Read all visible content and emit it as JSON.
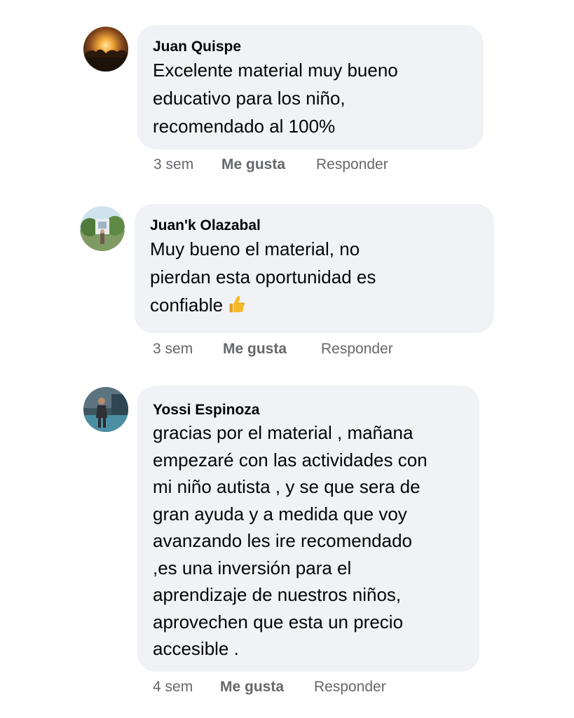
{
  "comments": [
    {
      "author": "Juan Quispe",
      "text": "Excelente material muy bueno\neducativo para los niño,\nrecomendado al 100%",
      "time": "3 sem",
      "like_label": "Me gusta",
      "reply_label": "Responder",
      "avatar_icon": "sunset-photo-avatar"
    },
    {
      "author": "Juan'k Olazabal",
      "text": "Muy bueno el material, no\npierdan esta oportunidad es\nconfiable",
      "emoji": "thumbs-up",
      "time": "3 sem",
      "like_label": "Me gusta",
      "reply_label": "Responder",
      "avatar_icon": "park-photo-avatar"
    },
    {
      "author": "Yossi Espinoza",
      "text": "gracias por el material , mañana\nempezaré con las actividades con\nmi niño autista , y se que sera de\ngran ayuda y a medida que voy\navanzando les ire recomendado\n,es una inversión para el\naprendizaje de nuestros niños,\naprovechen que esta un precio\naccesible .",
      "time": "4 sem",
      "like_label": "Me gusta",
      "reply_label": "Responder",
      "avatar_icon": "person-photo-avatar"
    }
  ],
  "colors": {
    "bubble_bg": "#f0f2f5",
    "text": "#050505",
    "meta": "#65676b",
    "thumb": "#f7b928"
  }
}
